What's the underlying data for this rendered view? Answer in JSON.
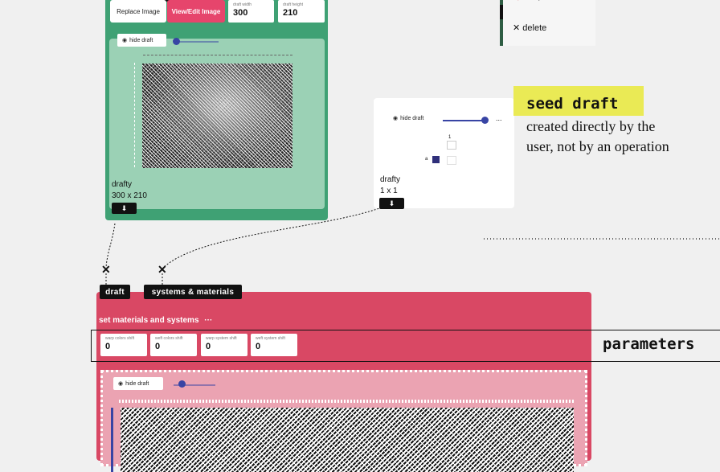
{
  "upload_op": {
    "replace_button": "Replace Image",
    "view_edit_button": "View/Edit Image",
    "draft_width_label": "draft width",
    "draft_width_value": "300",
    "draft_height_label": "draft height",
    "draft_height_value": "210",
    "hide_draft": "hide draft",
    "draft_name": "drafty",
    "draft_size": "300 x 210"
  },
  "context_menu": {
    "help": "help",
    "delete": "delete"
  },
  "seed_draft": {
    "hide_draft": "hide draft",
    "more": "...",
    "col_label": "1",
    "row_label": "a",
    "draft_name": "drafty",
    "draft_size": "1 x 1"
  },
  "annotations": {
    "seed_tag": "seed draft",
    "seed_desc": "created directly by the user, not by an operation",
    "params": "parameters"
  },
  "connections": {
    "input_draft": "draft",
    "input_systems": "systems & materials"
  },
  "materials_op": {
    "title": "set materials and systems",
    "more": "···",
    "params": [
      {
        "label": "warp colors shift",
        "value": "0"
      },
      {
        "label": "weft colors shift",
        "value": "0"
      },
      {
        "label": "warp system shift",
        "value": "0"
      },
      {
        "label": "weft system shift",
        "value": "0"
      }
    ],
    "hide_draft": "hide draft"
  },
  "colors": {
    "upload_green": "#3fa174",
    "materials_pink": "#d94864",
    "annotation_yellow": "#eaea55",
    "slider_blue": "#3844a4"
  }
}
